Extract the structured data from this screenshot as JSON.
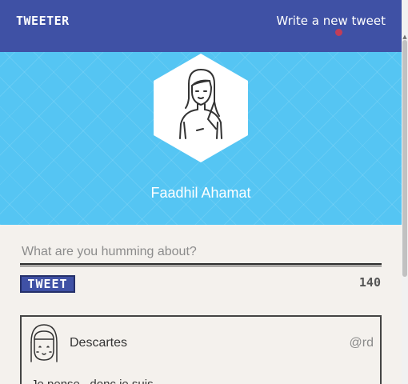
{
  "nav": {
    "brand": "TWEETER",
    "write_link": "Write a new tweet"
  },
  "profile": {
    "name": "Faadhil Ahamat",
    "avatar_icon": "female-user-avatar-icon"
  },
  "composer": {
    "placeholder": "What are you humming about?",
    "button_label": "TWEET",
    "char_count": "140"
  },
  "tweets": [
    {
      "author": "Descartes",
      "handle": "@rd",
      "text": "Je pense , donc je suis",
      "avatar_icon": "girl-avatar-icon"
    }
  ],
  "colors": {
    "nav_bg": "#3f51a5",
    "hero_bg": "#55c5f3",
    "page_bg": "#f4f1ed"
  }
}
